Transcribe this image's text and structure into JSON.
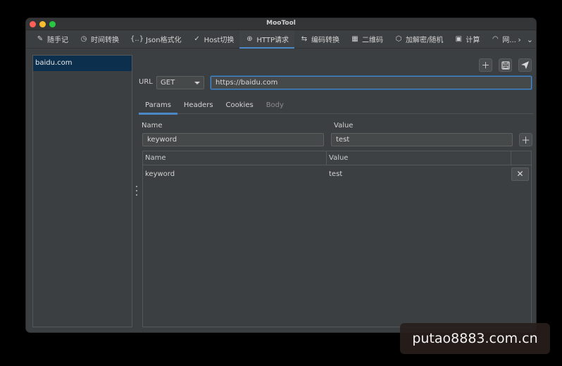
{
  "window": {
    "title": "MooTool"
  },
  "tabs": [
    {
      "icon": "✎",
      "icon_name": "pen-icon",
      "label": "随手记"
    },
    {
      "icon": "◷",
      "icon_name": "clock-icon",
      "label": "时间转换"
    },
    {
      "icon": "{..}",
      "icon_name": "braces-icon",
      "label": "Json格式化"
    },
    {
      "icon": "✓",
      "icon_name": "check-icon",
      "label": "Host切换"
    },
    {
      "icon": "⊕",
      "icon_name": "globe-icon",
      "label": "HTTP请求"
    },
    {
      "icon": "⇆",
      "icon_name": "swap-icon",
      "label": "编码转换"
    },
    {
      "icon": "▦",
      "icon_name": "qrcode-icon",
      "label": "二维码"
    },
    {
      "icon": "⬡",
      "icon_name": "cube-icon",
      "label": "加解密/随机"
    },
    {
      "icon": "▣",
      "icon_name": "calculator-icon",
      "label": "计算"
    },
    {
      "icon": "◠",
      "icon_name": "wifi-icon",
      "label": "网..."
    }
  ],
  "active_tab": "HTTP请求",
  "sidebar": {
    "items": [
      {
        "label": "baidu.com"
      }
    ]
  },
  "request": {
    "url_label": "URL",
    "method": "GET",
    "url": "https://baidu.com"
  },
  "subtabs": [
    {
      "label": "Params"
    },
    {
      "label": "Headers"
    },
    {
      "label": "Cookies"
    },
    {
      "label": "Body"
    }
  ],
  "params": {
    "name_label": "Name",
    "value_label": "Value",
    "name_value": "keyword",
    "value_value": "test",
    "table": {
      "columns": [
        "Name",
        "Value"
      ],
      "rows": [
        {
          "name": "keyword",
          "value": "test"
        }
      ]
    }
  },
  "watermark": "putao8883.com.cn",
  "colors": {
    "accent": "#4a88c7",
    "background": "#3c3f41"
  }
}
